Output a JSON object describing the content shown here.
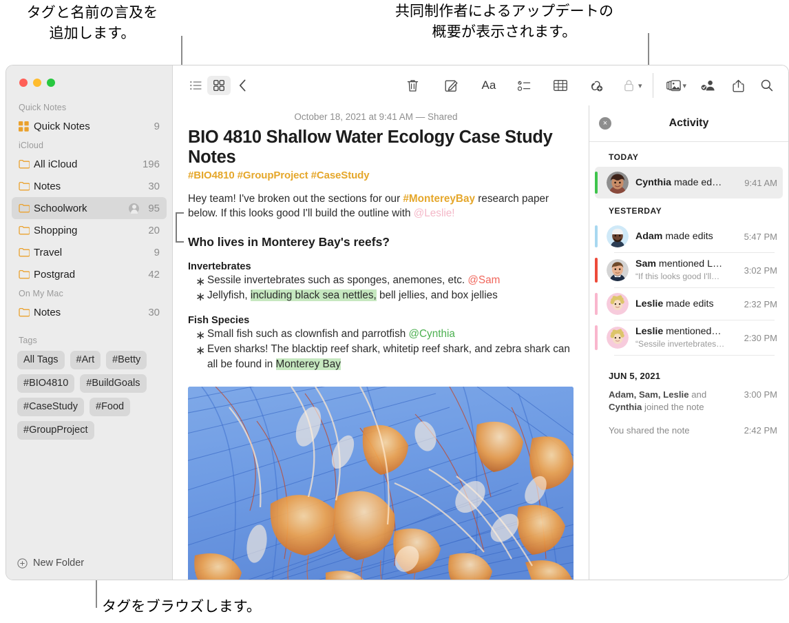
{
  "annotations": {
    "tags_callout": "タグと名前の言及を\n追加します。",
    "activity_callout": "共同制作者によるアップデートの\n概要が表示されます。",
    "browse_callout": "タグをブラウズします。"
  },
  "sidebar": {
    "sections": [
      {
        "label": "Quick Notes",
        "items": [
          {
            "label": "Quick Notes",
            "count": "9",
            "icon": "quick-notes-icon",
            "selected": false,
            "shared": false
          }
        ]
      },
      {
        "label": "iCloud",
        "items": [
          {
            "label": "All iCloud",
            "count": "196",
            "icon": "folder-icon",
            "selected": false,
            "shared": false
          },
          {
            "label": "Notes",
            "count": "30",
            "icon": "folder-icon",
            "selected": false,
            "shared": false
          },
          {
            "label": "Schoolwork",
            "count": "95",
            "icon": "folder-icon",
            "selected": true,
            "shared": true
          },
          {
            "label": "Shopping",
            "count": "20",
            "icon": "folder-icon",
            "selected": false,
            "shared": false
          },
          {
            "label": "Travel",
            "count": "9",
            "icon": "folder-icon",
            "selected": false,
            "shared": false
          },
          {
            "label": "Postgrad",
            "count": "42",
            "icon": "folder-icon",
            "selected": false,
            "shared": false
          }
        ]
      },
      {
        "label": "On My Mac",
        "items": [
          {
            "label": "Notes",
            "count": "30",
            "icon": "folder-icon",
            "selected": false,
            "shared": false
          }
        ]
      }
    ],
    "tags_label": "Tags",
    "tags": [
      "All Tags",
      "#Art",
      "#Betty",
      "#BIO4810",
      "#BuildGoals",
      "#CaseStudy",
      "#Food",
      "#GroupProject"
    ],
    "new_folder_label": "New Folder"
  },
  "toolbar": {
    "left": [
      {
        "name": "list-view-icon",
        "title": "List View"
      },
      {
        "name": "gallery-view-icon",
        "title": "Gallery View",
        "active": true
      },
      {
        "name": "back-chevron-icon",
        "title": "Back"
      }
    ],
    "right": [
      {
        "name": "trash-icon",
        "title": "Delete"
      },
      {
        "name": "compose-icon",
        "title": "New Note"
      },
      {
        "name": "format-aa-icon",
        "title": "Format",
        "text": "Aa"
      },
      {
        "name": "checklist-icon",
        "title": "Checklist"
      },
      {
        "name": "table-icon",
        "title": "Table"
      },
      {
        "name": "add-link-icon",
        "title": "Add Link"
      },
      {
        "name": "lock-icon",
        "title": "Lock Note",
        "dim": true
      },
      {
        "name": "media-icon",
        "title": "Media"
      },
      {
        "name": "share-people-icon",
        "title": "Collaborate"
      },
      {
        "name": "share-icon",
        "title": "Share"
      },
      {
        "name": "search-icon",
        "title": "Search"
      }
    ]
  },
  "note": {
    "date": "October 18, 2021 at 9:41 AM — Shared",
    "title": "BIO 4810 Shallow Water Ecology Case Study Notes",
    "hashtags": "#BIO4810 #GroupProject #CaseStudy",
    "paragraph": {
      "p1": "Hey team! I've broken out the sections for our ",
      "tag1": "#MontereyBay",
      "p2": " research paper below. If this looks good I'll build the outline with ",
      "mention1": "@Leslie!"
    },
    "heading": "Who lives in Monterey Bay's reefs?",
    "groups": [
      {
        "heading": "Invertebrates",
        "items": [
          {
            "pre": "Sessile invertebrates such as sponges, anemones, etc. ",
            "mention": "@Sam",
            "mention_color": "red",
            "post": ""
          },
          {
            "pre": "Jellyfish, ",
            "highlight": "including black sea nettles,",
            "post": " bell jellies, and box jellies"
          }
        ]
      },
      {
        "heading": "Fish Species",
        "items": [
          {
            "pre": "Small fish such as clownfish and parrotfish ",
            "mention": "@Cynthia",
            "mention_color": "green",
            "post": ""
          },
          {
            "pre": "Even sharks! The blacktip reef shark, whitetip reef shark, and zebra shark can all be found in ",
            "highlight": "Monterey Bay",
            "post": ""
          }
        ]
      }
    ],
    "image_alt": "jellyfish-photo"
  },
  "activity": {
    "title": "Activity",
    "close_label": "×",
    "groups": [
      {
        "day": "TODAY",
        "big": false,
        "entries": [
          {
            "name": "Cynthia",
            "action": " made ed…",
            "quote": "",
            "time": "9:41 AM",
            "bar_color": "#3ec44c",
            "avatar": "cynthia",
            "selected": true
          }
        ]
      },
      {
        "day": "YESTERDAY",
        "big": false,
        "entries": [
          {
            "name": "Adam",
            "action": " made edits",
            "quote": "",
            "time": "5:47 PM",
            "bar_color": "#a8d8f0",
            "avatar": "adam",
            "selected": false
          },
          {
            "name": "Sam",
            "action": " mentioned L…",
            "quote": "“If this looks good I'll…",
            "time": "3:02 PM",
            "bar_color": "#ed4a3a",
            "avatar": "sam",
            "selected": false
          },
          {
            "name": "Leslie",
            "action": " made edits",
            "quote": "",
            "time": "2:32 PM",
            "bar_color": "#f9b6cd",
            "avatar": "leslie",
            "selected": false
          },
          {
            "name": "Leslie",
            "action": " mentioned…",
            "quote": "“Sessile invertebrates…",
            "time": "2:30 PM",
            "bar_color": "#f9b6cd",
            "avatar": "leslie",
            "selected": false
          }
        ]
      }
    ],
    "archive_day": "JUN 5, 2021",
    "archive_entries": [
      {
        "bold1": "Adam, Sam, Leslie",
        "mid": " and ",
        "bold2": "Cynthia",
        "tail": " joined the note",
        "time": "3:00 PM"
      },
      {
        "bold1": "",
        "mid": "You shared the note",
        "bold2": "",
        "tail": "",
        "time": "2:42 PM"
      }
    ]
  }
}
